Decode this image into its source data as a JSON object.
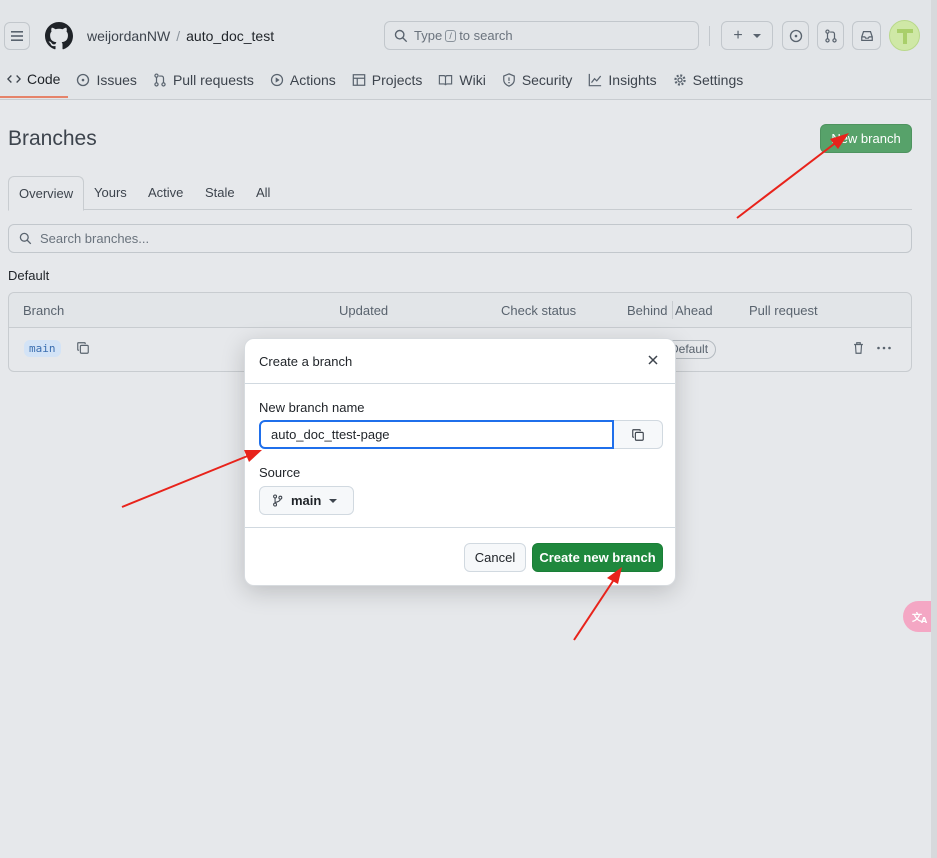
{
  "header": {
    "owner": "weijordanNW",
    "separator": "/",
    "repo": "auto_doc_test",
    "search_prefix": "Type",
    "search_kbd": "/",
    "search_suffix": "to search"
  },
  "repo_tabs": [
    {
      "label": "Code",
      "icon": "code-icon",
      "active": true
    },
    {
      "label": "Issues",
      "icon": "issue-icon"
    },
    {
      "label": "Pull requests",
      "icon": "pull-request-icon"
    },
    {
      "label": "Actions",
      "icon": "play-icon"
    },
    {
      "label": "Projects",
      "icon": "table-icon"
    },
    {
      "label": "Wiki",
      "icon": "book-icon"
    },
    {
      "label": "Security",
      "icon": "shield-icon"
    },
    {
      "label": "Insights",
      "icon": "graph-icon"
    },
    {
      "label": "Settings",
      "icon": "gear-icon"
    }
  ],
  "page": {
    "title": "Branches",
    "new_branch_label": "New branch"
  },
  "subnav": [
    {
      "label": "Overview",
      "active": true
    },
    {
      "label": "Yours"
    },
    {
      "label": "Active"
    },
    {
      "label": "Stale"
    },
    {
      "label": "All"
    }
  ],
  "branch_search": {
    "placeholder": "Search branches..."
  },
  "section_label": "Default",
  "table": {
    "headers": [
      "Branch",
      "Updated",
      "Check status",
      "Behind",
      "Ahead",
      "Pull request"
    ],
    "rows": [
      {
        "branch": "main",
        "badge": "Default"
      }
    ]
  },
  "modal": {
    "title": "Create a branch",
    "name_label": "New branch name",
    "name_value": "auto_doc_ttest-page",
    "source_label": "Source",
    "source_value": "main",
    "cancel_label": "Cancel",
    "create_label": "Create new branch"
  },
  "translate_widget": {
    "icon": "translate-icon"
  },
  "colors": {
    "accent_green": "#1f883d",
    "annotation_red": "#e8231b",
    "focus_blue": "#1f6feb"
  }
}
